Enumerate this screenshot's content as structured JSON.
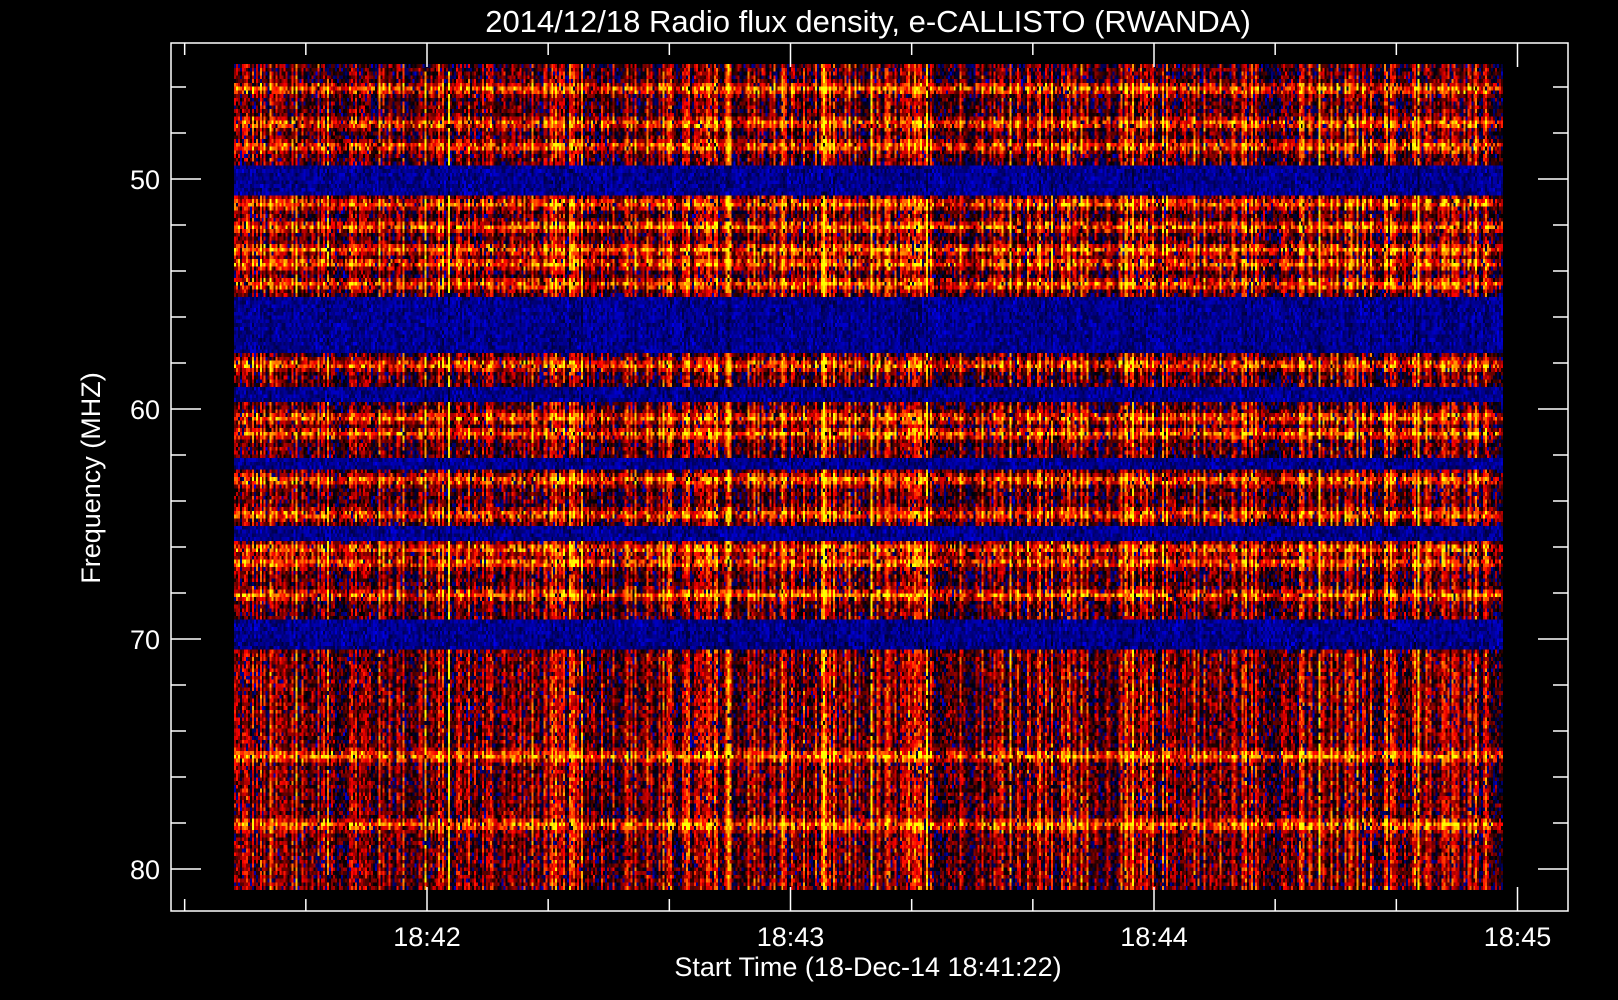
{
  "chart_data": {
    "type": "heatmap",
    "title": "2014/12/18  Radio flux density, e-CALLISTO (RWANDA)",
    "xlabel": "Start Time (18-Dec-14 18:41:22)",
    "ylabel": "Frequency (MHZ)",
    "x_tick_labels": [
      "18:42",
      "18:43",
      "18:44",
      "18:45"
    ],
    "x_tick_seconds": [
      0,
      60,
      120,
      180
    ],
    "x_minor_tick_step_seconds": 20,
    "x_range_seconds_from_1842": [
      -42,
      186
    ],
    "data_x_range_seconds_from_1842": [
      -32,
      177
    ],
    "y_tick_labels": [
      "50",
      "60",
      "70",
      "80"
    ],
    "y_tick_values": [
      50,
      60,
      70,
      80
    ],
    "y_minor_tick_step": 2,
    "ylim": [
      44.1,
      81.8
    ],
    "data_y_range_mhz": [
      45,
      80.9
    ],
    "y_inverted": true,
    "colormap": [
      "#0000ff",
      "#000000",
      "#ff0000",
      "#ffff00"
    ],
    "bright_bands_mhz": [
      46,
      47.5,
      48.5,
      51,
      52,
      53,
      53.6,
      54.5,
      58,
      60.3,
      61,
      63,
      64.5,
      66,
      66.6,
      68,
      75,
      78
    ],
    "quiet_bands_mhz": [
      [
        49.3,
        50.6
      ],
      [
        55,
        57.5
      ],
      [
        59,
        59.6
      ],
      [
        62,
        62.6
      ],
      [
        65,
        65.6
      ],
      [
        69,
        70.3
      ]
    ]
  }
}
